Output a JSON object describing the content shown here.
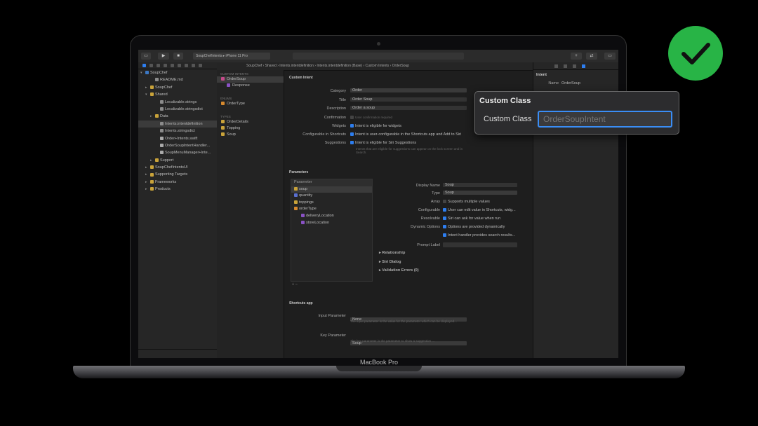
{
  "device": {
    "brand_label": "MacBook Pro"
  },
  "toolbar": {
    "scheme": "SoupChefIntents ▸ iPhone 11 Pro"
  },
  "navigator": {
    "items": [
      {
        "label": "SoupChef",
        "kind": "proj",
        "indent": 0,
        "tri": "▾"
      },
      {
        "label": "README.md",
        "kind": "file",
        "indent": 2,
        "tri": ""
      },
      {
        "label": "SoupChef",
        "kind": "folder",
        "indent": 1,
        "tri": "▸"
      },
      {
        "label": "Shared",
        "kind": "folder",
        "indent": 1,
        "tri": "▾"
      },
      {
        "label": "Localizable.strings",
        "kind": "file",
        "indent": 3,
        "tri": ""
      },
      {
        "label": "Localizable.stringsdict",
        "kind": "file",
        "indent": 3,
        "tri": ""
      },
      {
        "label": "Data",
        "kind": "folder",
        "indent": 2,
        "tri": "▸"
      },
      {
        "label": "Intents.intentdefinition",
        "kind": "file",
        "indent": 3,
        "tri": "",
        "selected": true
      },
      {
        "label": "Intents.stringsdict",
        "kind": "file",
        "indent": 3,
        "tri": ""
      },
      {
        "label": "Order+Intents.swift",
        "kind": "swift",
        "indent": 3,
        "tri": ""
      },
      {
        "label": "OrderSoupIntentHandler...",
        "kind": "swift",
        "indent": 3,
        "tri": ""
      },
      {
        "label": "SoupMenuManager+Inte...",
        "kind": "swift",
        "indent": 3,
        "tri": ""
      },
      {
        "label": "Support",
        "kind": "folder",
        "indent": 2,
        "tri": "▸"
      },
      {
        "label": "SoupChefIntentsUI",
        "kind": "folder",
        "indent": 1,
        "tri": "▸"
      },
      {
        "label": "Supporting Targets",
        "kind": "folder",
        "indent": 1,
        "tri": "▸"
      },
      {
        "label": "Frameworks",
        "kind": "folder",
        "indent": 1,
        "tri": "▸"
      },
      {
        "label": "Products",
        "kind": "folder",
        "indent": 1,
        "tri": "▸"
      }
    ]
  },
  "jumpbar": {
    "path": "SoupChef  ›  Shared  ›  Intents.intentdefinition  ›  Intents.intentdefinition (Base)  ›  Custom Intents  ›  OrderSoup"
  },
  "intent_list": {
    "custom_intents_header": "CUSTOM INTENTS",
    "intents": [
      {
        "label": "OrderSoup",
        "color": "#c44a8a",
        "selected": true,
        "indent": 0
      },
      {
        "label": "Response",
        "color": "#8a52c4",
        "indent": 1
      }
    ],
    "enums_header": "ENUMS",
    "enums": [
      {
        "label": "OrderType",
        "color": "#d6892e"
      }
    ],
    "types_header": "TYPES",
    "types": [
      {
        "label": "OrderDetails",
        "color": "#c9a33a"
      },
      {
        "label": "Topping",
        "color": "#c9a33a"
      },
      {
        "label": "Soup",
        "color": "#c9a33a"
      }
    ]
  },
  "custom_intent": {
    "header": "Custom Intent",
    "category_label": "Category",
    "category_value": "Order",
    "title_label": "Title",
    "title_value": "Order Soup",
    "description_label": "Description",
    "description_value": "Order a soup",
    "confirmation_label": "Confirmation",
    "confirmation_value": "User confirmation required",
    "widgets_label": "Widgets",
    "widgets_value": "Intent is eligible for widgets",
    "configurable_label": "Configurable in Shortcuts",
    "configurable_value": "Intent is user-configurable in the Shortcuts app and Add to Siri",
    "suggestions_label": "Suggestions",
    "suggestions_value": "Intent is eligible for Siri Suggestions",
    "suggestions_help": "Intents that are eligible for suggestions can appear on the lock screen and in Search."
  },
  "parameters": {
    "header": "Parameters",
    "column_header": "Parameter",
    "rows": [
      {
        "label": "soup",
        "color": "#c9a33a",
        "selected": true,
        "indent": 0
      },
      {
        "label": "quantity",
        "color": "#5a6fd0",
        "indent": 0
      },
      {
        "label": "toppings",
        "color": "#c9a33a",
        "indent": 0
      },
      {
        "label": "orderType",
        "color": "#d6892e",
        "indent": 0
      },
      {
        "label": "deliveryLocation",
        "color": "#8a52c4",
        "indent": 1
      },
      {
        "label": "storeLocation",
        "color": "#8a52c4",
        "indent": 1
      }
    ],
    "display_name_label": "Display Name",
    "display_name_value": "Soup",
    "type_label": "Type",
    "type_value": "Soup",
    "array_label": "Array",
    "array_value": "Supports multiple values",
    "configurable_label": "Configurable",
    "configurable_value": "User can edit value in Shortcuts, widg...",
    "resolvable_label": "Resolvable",
    "resolvable_value": "Siri can ask for value when run",
    "dynamic_label": "Dynamic Options",
    "dynamic_value": "Options are provided dynamically",
    "handler_value": "Intent handler provides search results...",
    "prompt_label": "Prompt Label",
    "relationship": "Relationship",
    "siri_dialog": "Siri Dialog",
    "validation_errors": "Validation Errors (0)"
  },
  "shortcuts_app": {
    "header": "Shortcuts app",
    "input_parameter_label": "Input Parameter",
    "input_parameter_value": "None",
    "input_help": "The input parameter is the value for the parameter which can be displayed...",
    "key_parameter_label": "Key Parameter",
    "key_parameter_value": "Soup",
    "key_help": "The key parameter is the parameter to show a suggestion ..."
  },
  "inspector": {
    "section": "Intent",
    "name_label": "Name",
    "name_value": "OrderSoup"
  },
  "callout": {
    "title": "Custom Class",
    "label": "Custom Class",
    "placeholder": "OrderSoupIntent"
  },
  "colors": {
    "accent": "#2d7ef0",
    "check_green": "#28b446"
  }
}
